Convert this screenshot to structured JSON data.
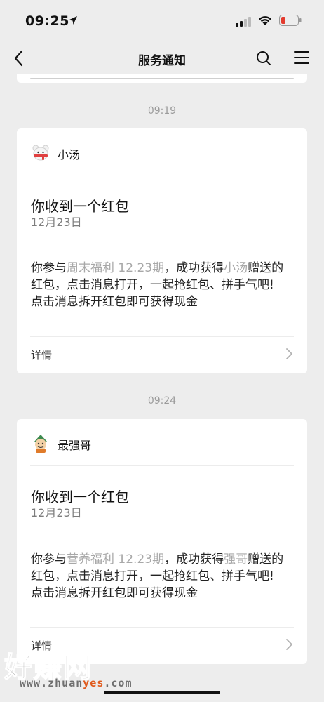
{
  "status_bar": {
    "time": "09:25",
    "icons": [
      "location-arrow-icon",
      "cellular-signal-icon",
      "wifi-icon",
      "battery-icon"
    ],
    "battery_color": "#e33b2e"
  },
  "nav": {
    "title": "服务通知",
    "back_icon": "chevron-left-icon",
    "search_icon": "search-icon",
    "menu_icon": "hamburger-menu-icon"
  },
  "messages": [
    {
      "time": "09:19",
      "sender": "小汤",
      "avatar_icon": "polar-bear-avatar",
      "title": "你收到一个红包",
      "date": "12月23日",
      "body": {
        "p1": "你参与",
        "activity": "周末福利 12.23期",
        "p2": "，成功获得",
        "giver": "小汤",
        "p3": "赠送的红包，点击消息打开，一起抢红包、拼手气吧!",
        "line2": "点击消息拆开红包即可获得现金"
      },
      "footer": "详情"
    },
    {
      "time": "09:24",
      "sender": "最强哥",
      "avatar_icon": "cartoon-character-avatar",
      "title": "你收到一个红包",
      "date": "12月23日",
      "body": {
        "p1": "你参与",
        "activity": "营养福利 12.23期",
        "p2": "，成功获得",
        "giver": "强哥",
        "p3": "赠送的红包，点击消息打开，一起抢红包、拼手气吧!",
        "line2": "点击消息拆开红包即可获得现金"
      },
      "footer": "详情"
    }
  ],
  "watermark": {
    "title": "好赚网",
    "url_a": "www.zhuan",
    "url_b": "yes",
    "url_c": ".com"
  },
  "colors": {
    "background": "#ededed",
    "card": "#ffffff",
    "highlight_text": "#a8a8a8",
    "watermark_accent": "#e05a1c"
  }
}
